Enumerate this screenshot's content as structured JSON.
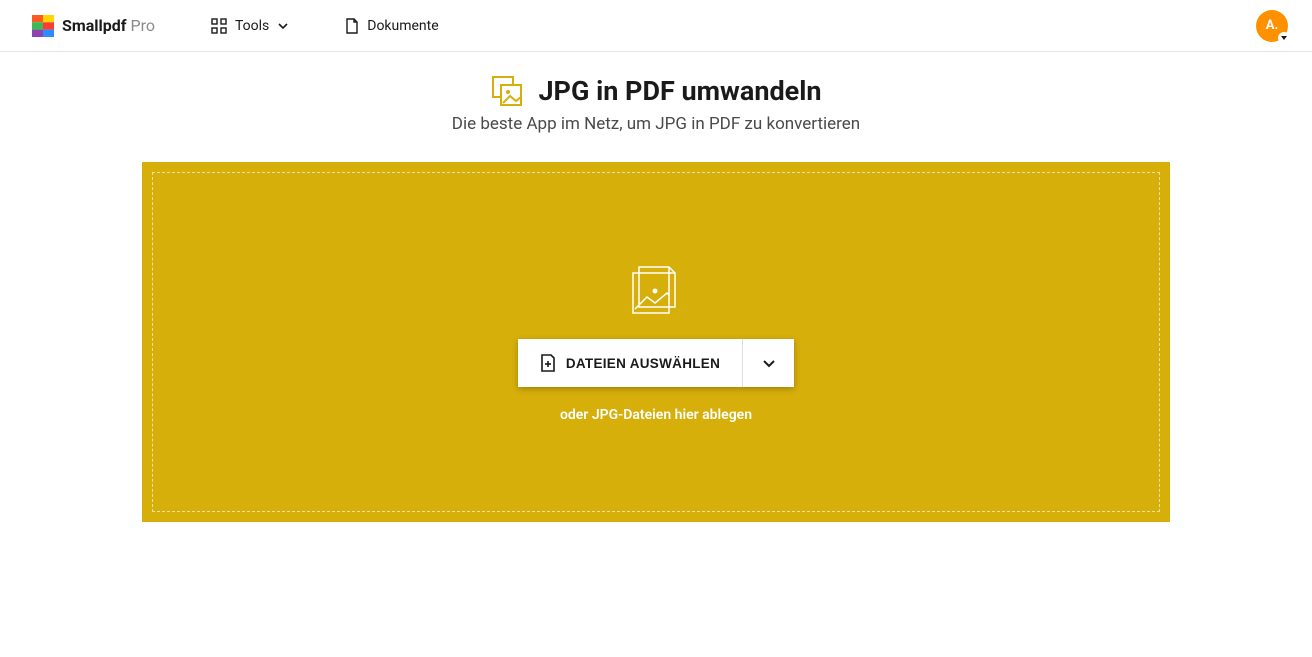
{
  "brand": {
    "name": "Smallpdf",
    "tier": "Pro"
  },
  "nav": {
    "tools": "Tools",
    "documents": "Dokumente"
  },
  "avatar_initial": "A.",
  "page": {
    "title": "JPG in PDF umwandeln",
    "subtitle": "Die beste App im Netz, um JPG in PDF zu konvertieren"
  },
  "dropzone": {
    "button_label": "DATEIEN AUSWÄHLEN",
    "hint": "oder JPG-Dateien hier ablegen"
  },
  "colors": {
    "accent": "#d6af0b",
    "avatar": "#ff9100"
  }
}
